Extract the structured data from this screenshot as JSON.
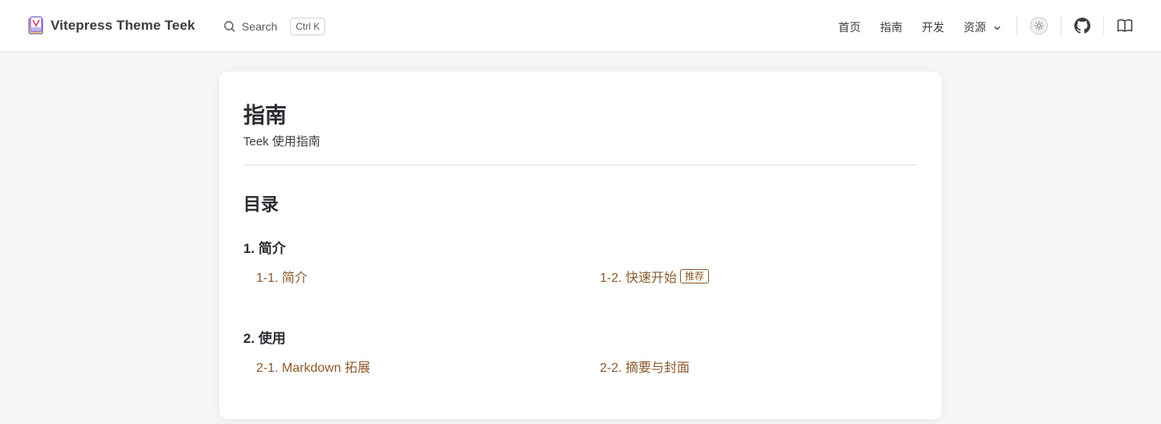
{
  "navbar": {
    "brand_title": "Vitepress Theme Teek",
    "search_label": "Search",
    "search_shortcut": "Ctrl K",
    "links": [
      {
        "label": "首页"
      },
      {
        "label": "指南"
      },
      {
        "label": "开发"
      },
      {
        "label": "资源"
      }
    ],
    "icons": [
      "theme-toggle-icon",
      "github-icon",
      "book-icon"
    ]
  },
  "page": {
    "title": "指南",
    "description": "Teek 使用指南",
    "toc_title": "目录",
    "groups": [
      {
        "title": "1. 简介",
        "items": [
          {
            "label": "1-1. 简介"
          },
          {
            "label": "1-2. 快速开始",
            "badge": "推荐"
          }
        ]
      },
      {
        "title": "2. 使用",
        "items": [
          {
            "label": "2-1. Markdown 拓展"
          },
          {
            "label": "2-2. 摘要与封面"
          }
        ]
      }
    ]
  },
  "colors": {
    "link": "#8b5a2b",
    "text": "#3c3c43",
    "background": "#f6f6f7"
  }
}
